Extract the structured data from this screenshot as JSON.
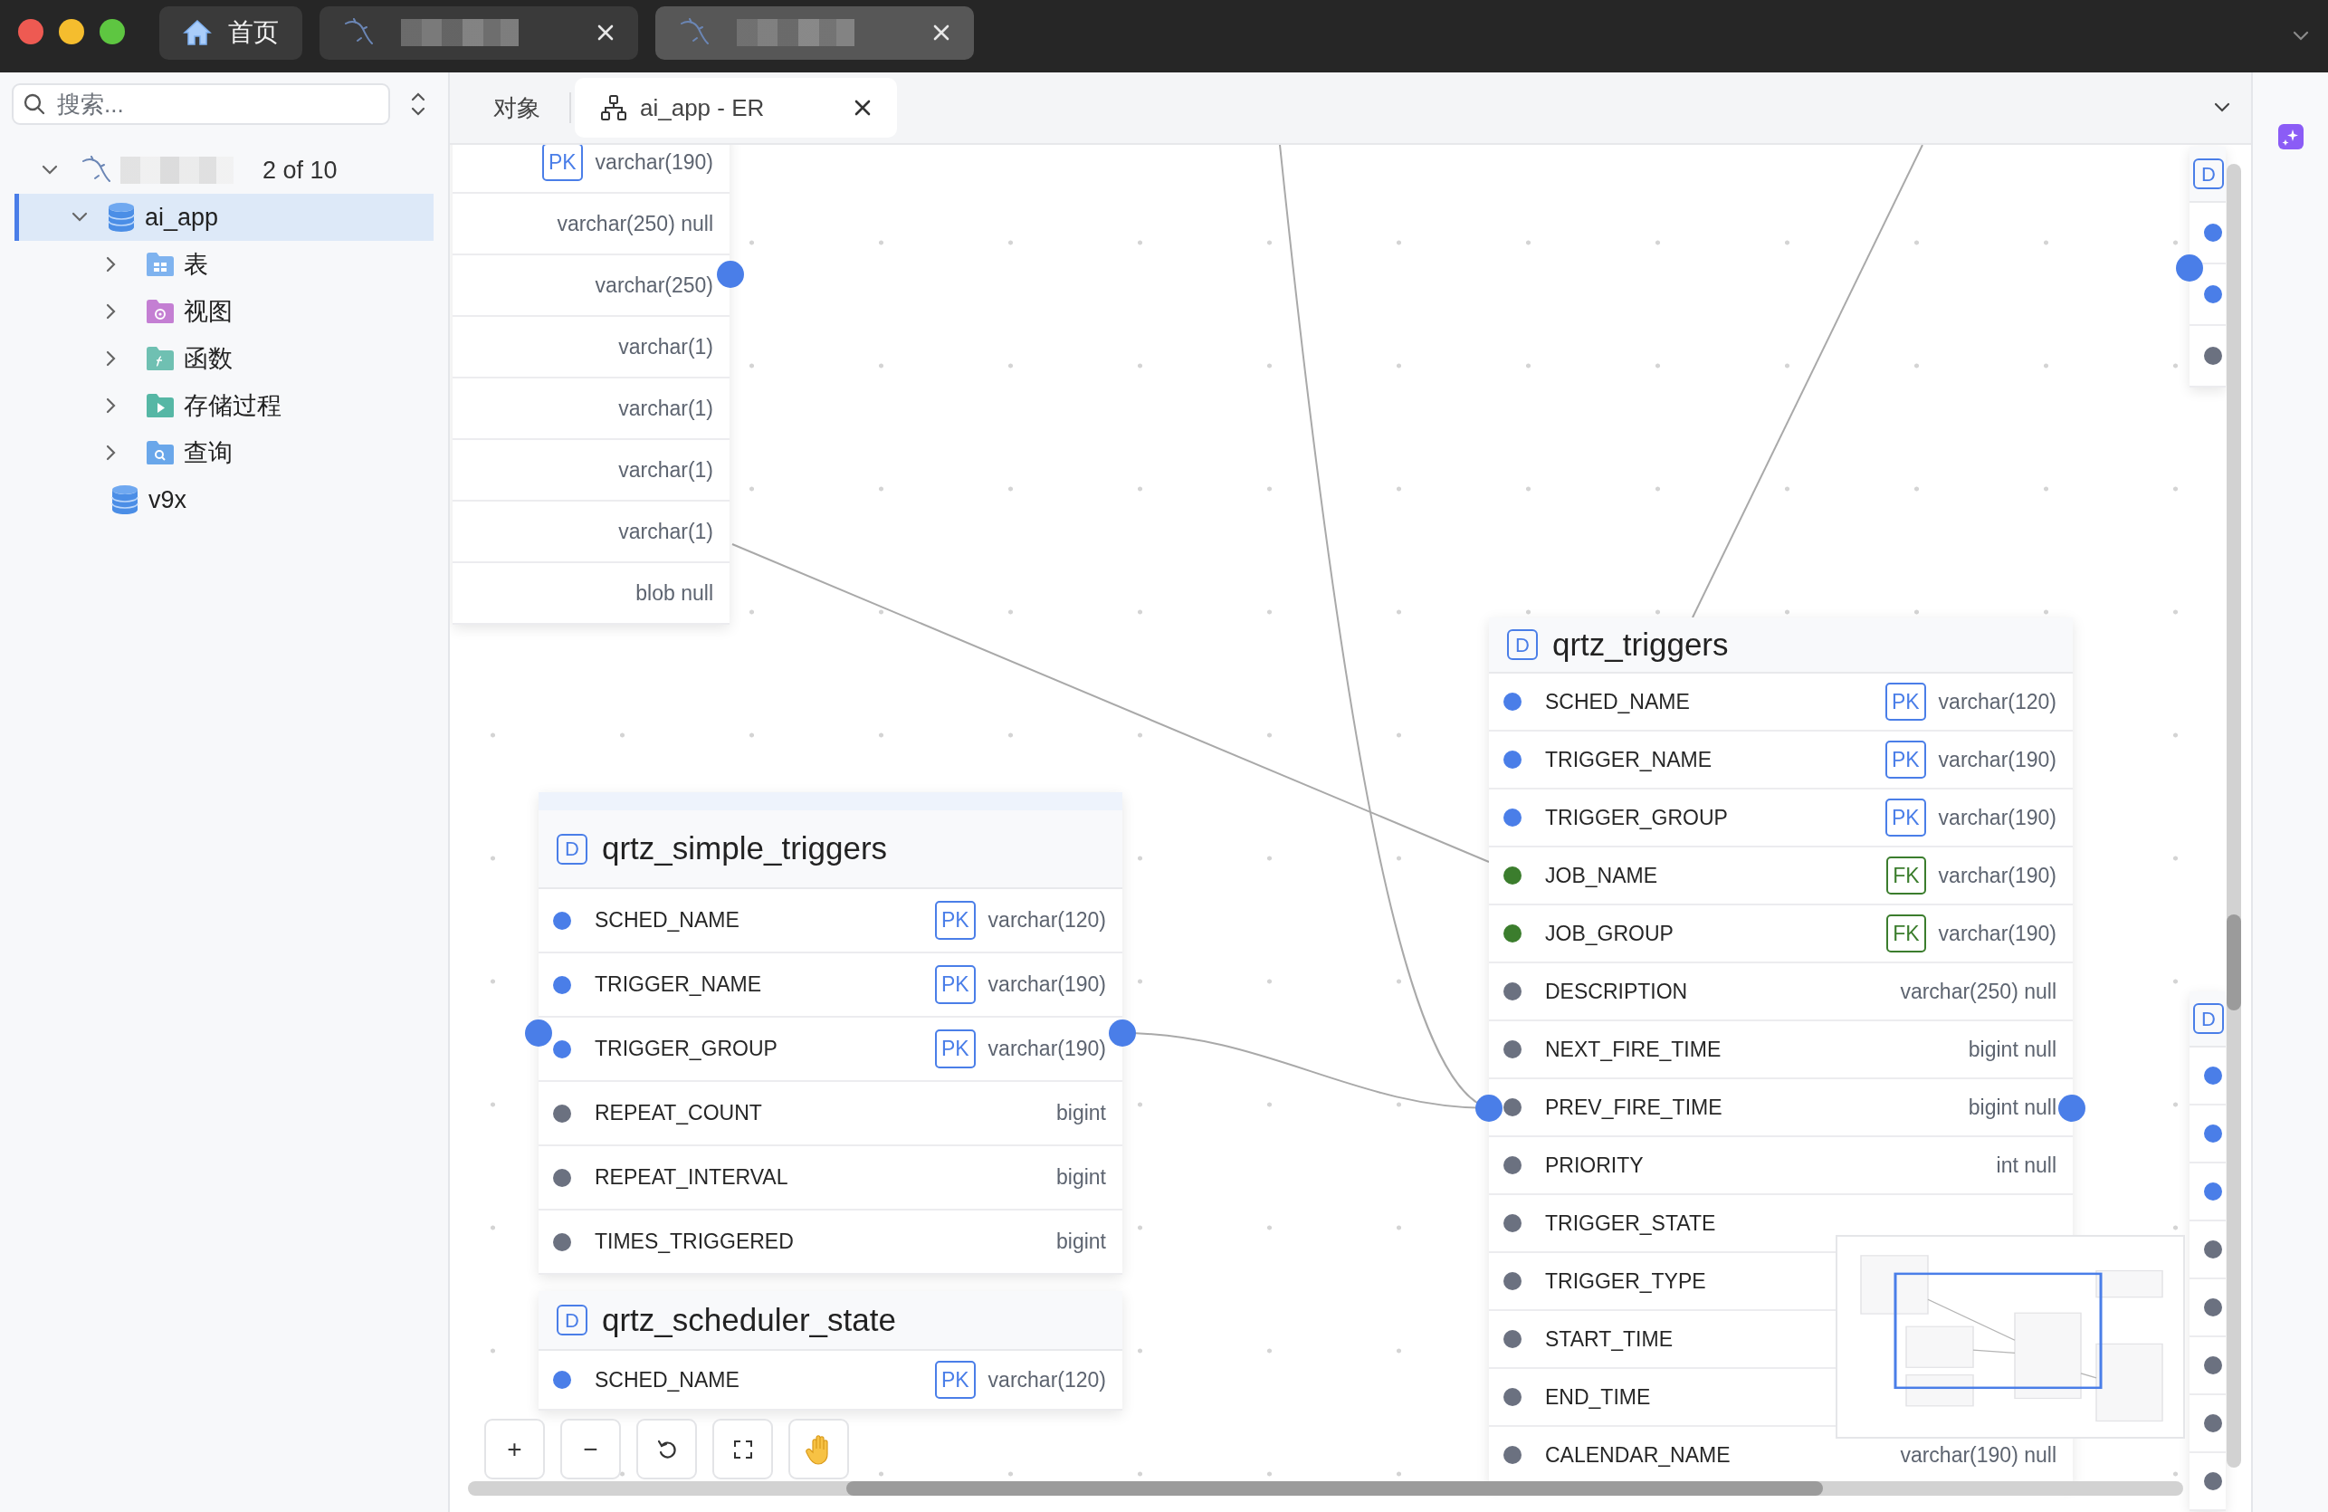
{
  "window": {
    "tabs": [
      {
        "kind": "home",
        "label": "首页",
        "selected": false
      },
      {
        "kind": "connection",
        "selected": false
      },
      {
        "kind": "connection",
        "selected": true
      }
    ]
  },
  "sidebar": {
    "search": {
      "placeholder": "搜索..."
    },
    "tree": [
      {
        "kind": "connection",
        "count": "2 of 10",
        "selected": false,
        "expanded": true,
        "children": [
          {
            "kind": "database",
            "label": "ai_app",
            "selected": true,
            "expanded": true,
            "children": [
              {
                "kind": "tables",
                "label": "表",
                "selected": false,
                "expanded": false
              },
              {
                "kind": "views",
                "label": "视图",
                "selected": false,
                "expanded": false
              },
              {
                "kind": "functions",
                "label": "函数",
                "selected": false,
                "expanded": false
              },
              {
                "kind": "procedures",
                "label": "存储过程",
                "selected": false,
                "expanded": false
              },
              {
                "kind": "queries",
                "label": "查询",
                "selected": false,
                "expanded": false
              }
            ]
          },
          {
            "kind": "database",
            "label": "v9x",
            "selected": false
          }
        ]
      }
    ]
  },
  "editor_tabs": [
    {
      "kind": "plain",
      "label": "对象",
      "selected": false
    },
    {
      "kind": "er",
      "label": "ai_app - ER",
      "selected": true
    }
  ],
  "er_tables": [
    {
      "columns": [
        {
          "key": "PK",
          "color": "#4a7ee8",
          "type": "varchar(190)"
        },
        {
          "type": "varchar(250) null"
        },
        {
          "type": "varchar(250)"
        },
        {
          "type": "varchar(1)"
        },
        {
          "type": "varchar(1)"
        },
        {
          "type": "varchar(1)"
        },
        {
          "type": "varchar(1)"
        },
        {
          "type": "blob null"
        }
      ]
    },
    {
      "badge": "D",
      "title": "qrtz_simple_triggers",
      "columns": [
        {
          "name": "SCHED_NAME",
          "key": "PK",
          "color": "#4a7ee8",
          "type": "varchar(120)"
        },
        {
          "name": "TRIGGER_NAME",
          "key": "PK",
          "color": "#4a7ee8",
          "type": "varchar(190)"
        },
        {
          "name": "TRIGGER_GROUP",
          "key": "PK",
          "color": "#4a7ee8",
          "type": "varchar(190)"
        },
        {
          "name": "REPEAT_COUNT",
          "color": "#6b7180",
          "type": "bigint"
        },
        {
          "name": "REPEAT_INTERVAL",
          "color": "#6b7180",
          "type": "bigint"
        },
        {
          "name": "TIMES_TRIGGERED",
          "color": "#6b7180",
          "type": "bigint"
        }
      ]
    },
    {
      "badge": "D",
      "title": "qrtz_triggers",
      "columns": [
        {
          "name": "SCHED_NAME",
          "key": "PK",
          "color": "#4a7ee8",
          "type": "varchar(120)"
        },
        {
          "name": "TRIGGER_NAME",
          "key": "PK",
          "color": "#4a7ee8",
          "type": "varchar(190)"
        },
        {
          "name": "TRIGGER_GROUP",
          "key": "PK",
          "color": "#4a7ee8",
          "type": "varchar(190)"
        },
        {
          "name": "JOB_NAME",
          "key": "FK",
          "color": "#3b7d2d",
          "type": "varchar(190)"
        },
        {
          "name": "JOB_GROUP",
          "key": "FK",
          "color": "#3b7d2d",
          "type": "varchar(190)"
        },
        {
          "name": "DESCRIPTION",
          "color": "#6b7180",
          "type": "varchar(250) null"
        },
        {
          "name": "NEXT_FIRE_TIME",
          "color": "#6b7180",
          "type": "bigint null"
        },
        {
          "name": "PREV_FIRE_TIME",
          "color": "#6b7180",
          "type": "bigint null"
        },
        {
          "name": "PRIORITY",
          "color": "#6b7180",
          "type": "int null"
        },
        {
          "name": "TRIGGER_STATE",
          "color": "#6b7180"
        },
        {
          "name": "TRIGGER_TYPE",
          "color": "#6b7180"
        },
        {
          "name": "START_TIME",
          "color": "#6b7180"
        },
        {
          "name": "END_TIME",
          "color": "#6b7180"
        },
        {
          "name": "CALENDAR_NAME",
          "color": "#6b7180",
          "type": "varchar(190) null"
        }
      ]
    },
    {
      "badge": "D",
      "title": "qrtz_scheduler_state",
      "columns": [
        {
          "name": "SCHED_NAME",
          "key": "PK",
          "color": "#4a7ee8",
          "type": "varchar(120)"
        }
      ]
    },
    {
      "badge": "D",
      "columns": [
        {
          "color": "#4a7ee8"
        },
        {
          "color": "#4a7ee8"
        },
        {
          "color": "#6b7180"
        }
      ]
    },
    {
      "badge": "D",
      "columns": [
        {
          "color": "#4a7ee8"
        },
        {
          "color": "#4a7ee8"
        },
        {
          "color": "#4a7ee8"
        },
        {
          "color": "#6b7180"
        },
        {
          "color": "#6b7180"
        },
        {
          "color": "#6b7180"
        },
        {
          "color": "#6b7180"
        },
        {
          "color": "#6b7180"
        }
      ]
    }
  ],
  "zoom_controls": [
    {
      "kind": "zoom_in",
      "label": "+"
    },
    {
      "kind": "zoom_out",
      "label": "−"
    },
    {
      "kind": "reset"
    },
    {
      "kind": "fit"
    },
    {
      "kind": "pan"
    }
  ]
}
